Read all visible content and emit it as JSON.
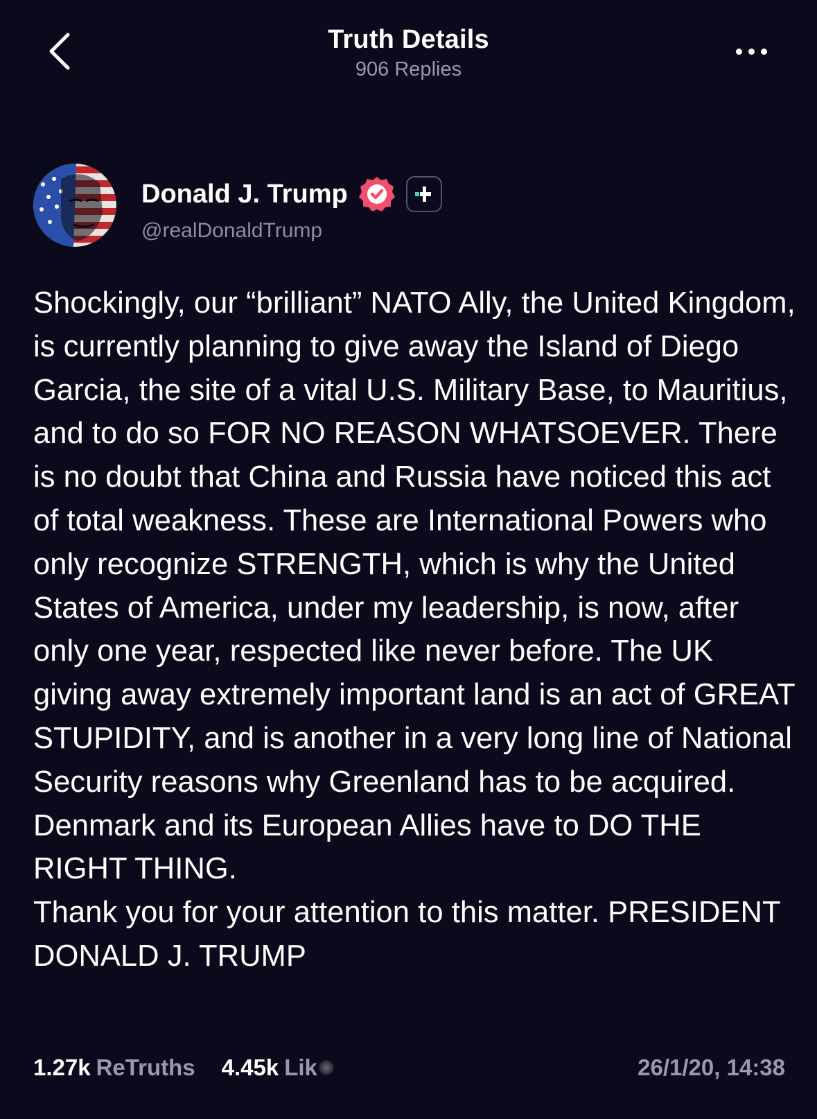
{
  "header": {
    "title": "Truth Details",
    "replies": "906 Replies"
  },
  "author": {
    "name": "Donald J. Trump",
    "handle": "@realDonaldTrump"
  },
  "post": {
    "text": "Shockingly, our “brilliant” NATO Ally, the United Kingdom, is currently planning to give away the Island of Diego Garcia, the site of a vital U.S. Military Base, to Mauritius, and to do so FOR NO REASON WHATSOEVER. There is no doubt that China and Russia have noticed this act of total weakness. These are International Powers who only recognize STRENGTH, which is why the United States of America, under my leadership, is now, after only one year, respected like never before. The UK giving away extremely important land is an act of GREAT STUPIDITY, and is another in a very long line of National Security reasons why Greenland has to be acquired. Denmark and its European Allies have to DO THE RIGHT THING.\nThank you for your attention to this matter. PRESIDENT DONALD J. TRUMP"
  },
  "stats": {
    "retruths_count": "1.27k",
    "retruths_label": "ReTruths",
    "likes_count": "4.45k",
    "likes_label": "Lik",
    "timestamp": "26/1/20, 14:38"
  },
  "colors": {
    "background": "#0b0a1c",
    "verified_badge": "#f0506e",
    "follow_accent": "#38d9c2",
    "muted_text": "#9a98ad"
  },
  "icons": {
    "back": "chevron-left-icon",
    "more": "more-horizontal-icon",
    "verified": "verified-badge-icon",
    "follow": "follow-plus-icon"
  }
}
